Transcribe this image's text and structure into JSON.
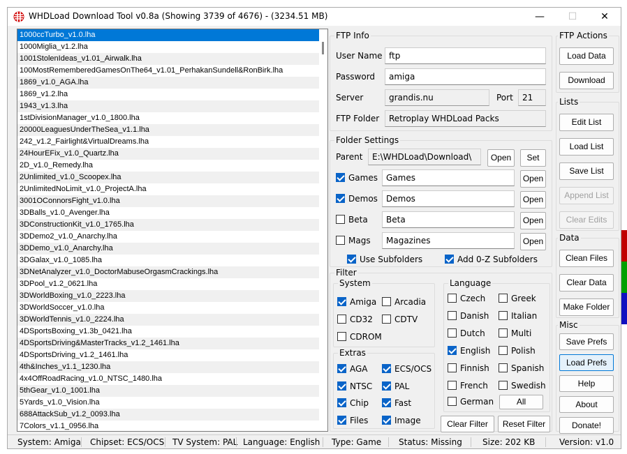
{
  "window": {
    "title": "WHDLoad Download Tool v0.8a (Showing 3739 of 4676) - (3234.51 MB)",
    "minimize": "—",
    "maximize": "☐",
    "close": "✕"
  },
  "file_list": [
    "1000ccTurbo_v1.0.lha",
    "1000Miglia_v1.2.lha",
    "1001StolenIdeas_v1.01_Airwalk.lha",
    "100MostRememberedGamesOnThe64_v1.01_PerhakanSundell&RonBirk.lha",
    "1869_v1.0_AGA.lha",
    "1869_v1.2.lha",
    "1943_v1.3.lha",
    "1stDivisionManager_v1.0_1800.lha",
    "20000LeaguesUnderTheSea_v1.1.lha",
    "242_v1.2_Fairlight&VirtualDreams.lha",
    "24HourEFix_v1.0_Quartz.lha",
    "2D_v1.0_Remedy.lha",
    "2Unlimited_v1.0_Scoopex.lha",
    "2UnlimitedNoLimit_v1.0_ProjectA.lha",
    "3001OConnorsFight_v1.0.lha",
    "3DBalls_v1.0_Avenger.lha",
    "3DConstructionKit_v1.0_1765.lha",
    "3DDemo2_v1.0_Anarchy.lha",
    "3DDemo_v1.0_Anarchy.lha",
    "3DGalax_v1.0_1085.lha",
    "3DNetAnalyzer_v1.0_DoctorMabuseOrgasmCrackings.lha",
    "3DPool_v1.2_0621.lha",
    "3DWorldBoxing_v1.0_2223.lha",
    "3DWorldSoccer_v1.0.lha",
    "3DWorldTennis_v1.0_2224.lha",
    "4DSportsBoxing_v1.3b_0421.lha",
    "4DSportsDriving&MasterTracks_v1.2_1461.lha",
    "4DSportsDriving_v1.2_1461.lha",
    "4th&Inches_v1.1_1230.lha",
    "4x4OffRoadRacing_v1.0_NTSC_1480.lha",
    "5thGear_v1.0_1001.lha",
    "5Yards_v1.0_Vision.lha",
    "688AttackSub_v1.2_0093.lha",
    "7Colors_v1.1_0956.lha"
  ],
  "ftp_info": {
    "title": "FTP Info",
    "user_label": "User Name",
    "user_value": "ftp",
    "password_label": "Password",
    "password_value": "amiga",
    "server_label": "Server",
    "server_value": "grandis.nu",
    "port_label": "Port",
    "port_value": "21",
    "folder_label": "FTP Folder",
    "folder_value": "Retroplay WHDLoad Packs"
  },
  "folder_settings": {
    "title": "Folder Settings",
    "parent_label": "Parent",
    "parent_value": "E:\\WHDLoad\\Download\\",
    "open": "Open",
    "set": "Set",
    "games_label": "Games",
    "games_value": "Games",
    "demos_label": "Demos",
    "demos_value": "Demos",
    "beta_label": "Beta",
    "beta_value": "Beta",
    "mags_label": "Mags",
    "mags_value": "Magazines",
    "use_subfolders": "Use Subfolders",
    "add_subfolders": "Add 0-Z Subfolders"
  },
  "filter": {
    "title": "Filter",
    "system_title": "System",
    "amiga": "Amiga",
    "arcadia": "Arcadia",
    "cd32": "CD32",
    "cdtv": "CDTV",
    "cdrom": "CDROM",
    "extras_title": "Extras",
    "aga": "AGA",
    "ecs": "ECS/OCS",
    "ntsc": "NTSC",
    "pal": "PAL",
    "chip": "Chip",
    "fast": "Fast",
    "files": "Files",
    "image": "Image",
    "language_title": "Language",
    "czech": "Czech",
    "greek": "Greek",
    "danish": "Danish",
    "italian": "Italian",
    "dutch": "Dutch",
    "multi": "Multi",
    "english": "English",
    "polish": "Polish",
    "finnish": "Finnish",
    "spanish": "Spanish",
    "french": "French",
    "swedish": "Swedish",
    "german": "German",
    "all": "All",
    "clear_filter": "Clear Filter",
    "reset_filter": "Reset Filter"
  },
  "ftp_actions": {
    "title": "FTP Actions",
    "load_data": "Load Data",
    "download": "Download"
  },
  "lists": {
    "title": "Lists",
    "edit_list": "Edit List",
    "load_list": "Load List",
    "save_list": "Save List",
    "append_list": "Append List",
    "clear_edits": "Clear Edits"
  },
  "data_group": {
    "title": "Data",
    "clean_files": "Clean Files",
    "clear_data": "Clear Data",
    "make_folder": "Make Folder"
  },
  "misc": {
    "title": "Misc",
    "save_prefs": "Save Prefs",
    "load_prefs": "Load Prefs",
    "help": "Help",
    "about": "About",
    "donate": "Donate!"
  },
  "status": {
    "system": "System: Amiga",
    "chipset": "Chipset: ECS/OCS",
    "tv": "TV System: PAL",
    "language": "Language: English",
    "type": "Type: Game",
    "state": "Status: Missing",
    "size": "Size: 202 KB",
    "version": "Version: v1.0"
  },
  "colors": {
    "accent": "#0078d7",
    "checkbox": "#0a64c8",
    "edge_red": "#c00000",
    "edge_green": "#00a000",
    "edge_blue": "#1010c0"
  }
}
